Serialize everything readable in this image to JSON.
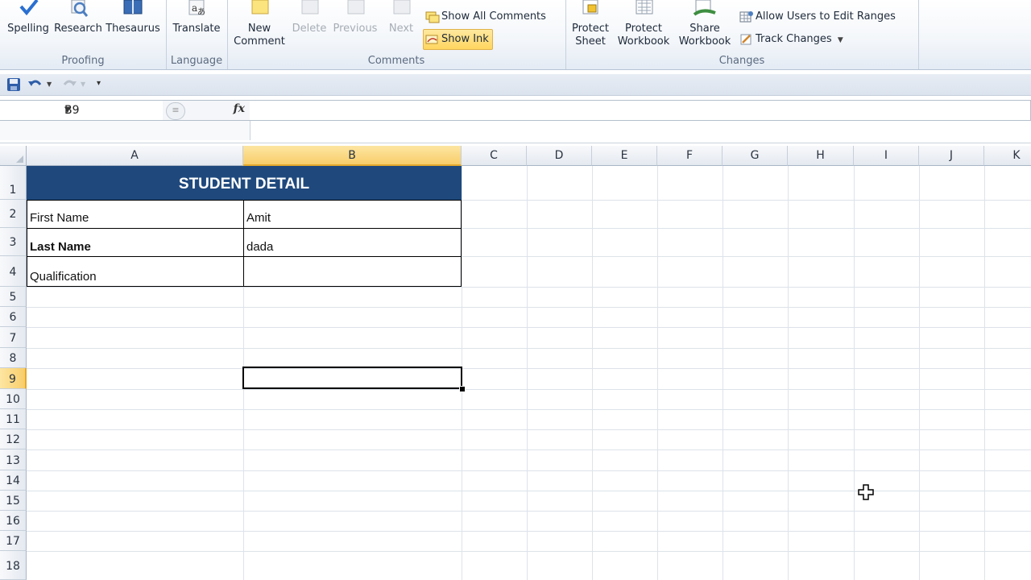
{
  "ribbon": {
    "proofing": {
      "label": "Proofing",
      "spelling": "Spelling",
      "research": "Research",
      "thesaurus": "Thesaurus"
    },
    "language": {
      "label": "Language",
      "translate": "Translate"
    },
    "comments": {
      "label": "Comments",
      "new_comment_1": "New",
      "new_comment_2": "Comment",
      "delete": "Delete",
      "previous": "Previous",
      "next": "Next",
      "show_all_comments": "Show All Comments",
      "show_ink": "Show Ink"
    },
    "changes": {
      "label": "Changes",
      "protect_sheet_1": "Protect",
      "protect_sheet_2": "Sheet",
      "protect_workbook_1": "Protect",
      "protect_workbook_2": "Workbook",
      "share_workbook_1": "Share",
      "share_workbook_2": "Workbook",
      "allow_users": "Allow Users to Edit Ranges",
      "track_changes": "Track Changes"
    }
  },
  "formula_bar": {
    "name_box": "B9",
    "fx": "fx",
    "value": ""
  },
  "sheet": {
    "columns": [
      "A",
      "B",
      "C",
      "D",
      "E",
      "F",
      "G",
      "H",
      "I",
      "J",
      "K"
    ],
    "rows": [
      "1",
      "2",
      "3",
      "4",
      "5",
      "6",
      "7",
      "8",
      "9",
      "10",
      "11",
      "12",
      "13",
      "14",
      "15",
      "16",
      "17",
      "18"
    ],
    "selected_column": "B",
    "selected_row": "9",
    "title": "STUDENT DETAIL",
    "cells": {
      "a2": "First Name",
      "b2": "Amit",
      "a3": "Last Name",
      "b3": "dada",
      "a4": "Qualification",
      "b4": ""
    }
  },
  "colors": {
    "header_fill": "#1f497d",
    "selection_accent": "#f8cd6a"
  }
}
